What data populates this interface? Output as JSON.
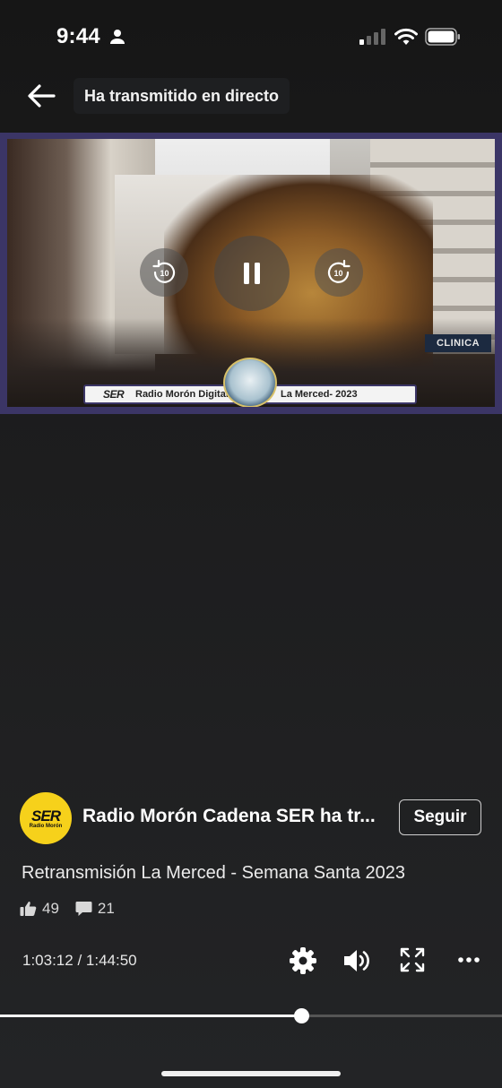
{
  "status_bar": {
    "time": "9:44",
    "icons": [
      "person-icon",
      "signal-icon",
      "wifi-icon",
      "battery-icon"
    ]
  },
  "header": {
    "title": "Ha transmitido en directo",
    "back_icon": "arrow-left-icon"
  },
  "video": {
    "overlay": {
      "brand": "SER",
      "station": "Radio Morón Digital",
      "event": "La Merced- 2023",
      "sign": "CLINICA"
    },
    "controls": {
      "rewind_label": "10",
      "forward_label": "10",
      "state": "playing"
    }
  },
  "channel": {
    "avatar_logo": "SER",
    "avatar_sub": "Radio Morón",
    "name": "Radio Morón Cadena SER ha tr...",
    "follow_label": "Seguir"
  },
  "post": {
    "title": "Retransmisión La Merced - Semana Santa 2023",
    "likes": "49",
    "comments": "21"
  },
  "player": {
    "time_display": "1:03:12 / 1:44:50",
    "progress_fraction": 0.6
  },
  "colors": {
    "frame": "#3b3566",
    "avatar_bg": "#f6d11b",
    "background": "#1c1c1d"
  }
}
